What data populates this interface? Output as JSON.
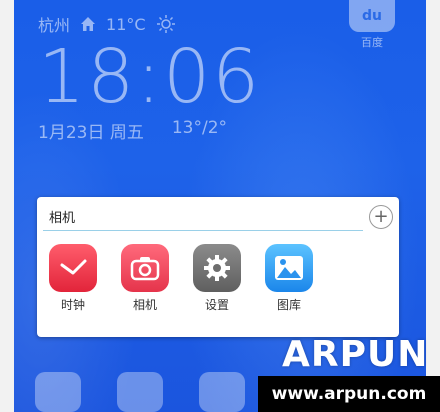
{
  "status": {
    "city": "杭州",
    "temperature": "11°C",
    "time": "18:06",
    "date": "1月23日",
    "weekday": "周五",
    "temp_range": "13°/2°"
  },
  "home_apps": {
    "baidu_label": "百度",
    "baidu_logo": "du"
  },
  "folder": {
    "name_value": "相机",
    "add_label": "+",
    "apps": [
      {
        "label": "时钟",
        "icon": "clock-icon"
      },
      {
        "label": "相机",
        "icon": "camera-icon"
      },
      {
        "label": "设置",
        "icon": "settings-gear-icon"
      },
      {
        "label": "图库",
        "icon": "gallery-icon"
      }
    ]
  },
  "watermark": {
    "logo_text": "ARPUN",
    "url_text": "www.arpun.com"
  }
}
